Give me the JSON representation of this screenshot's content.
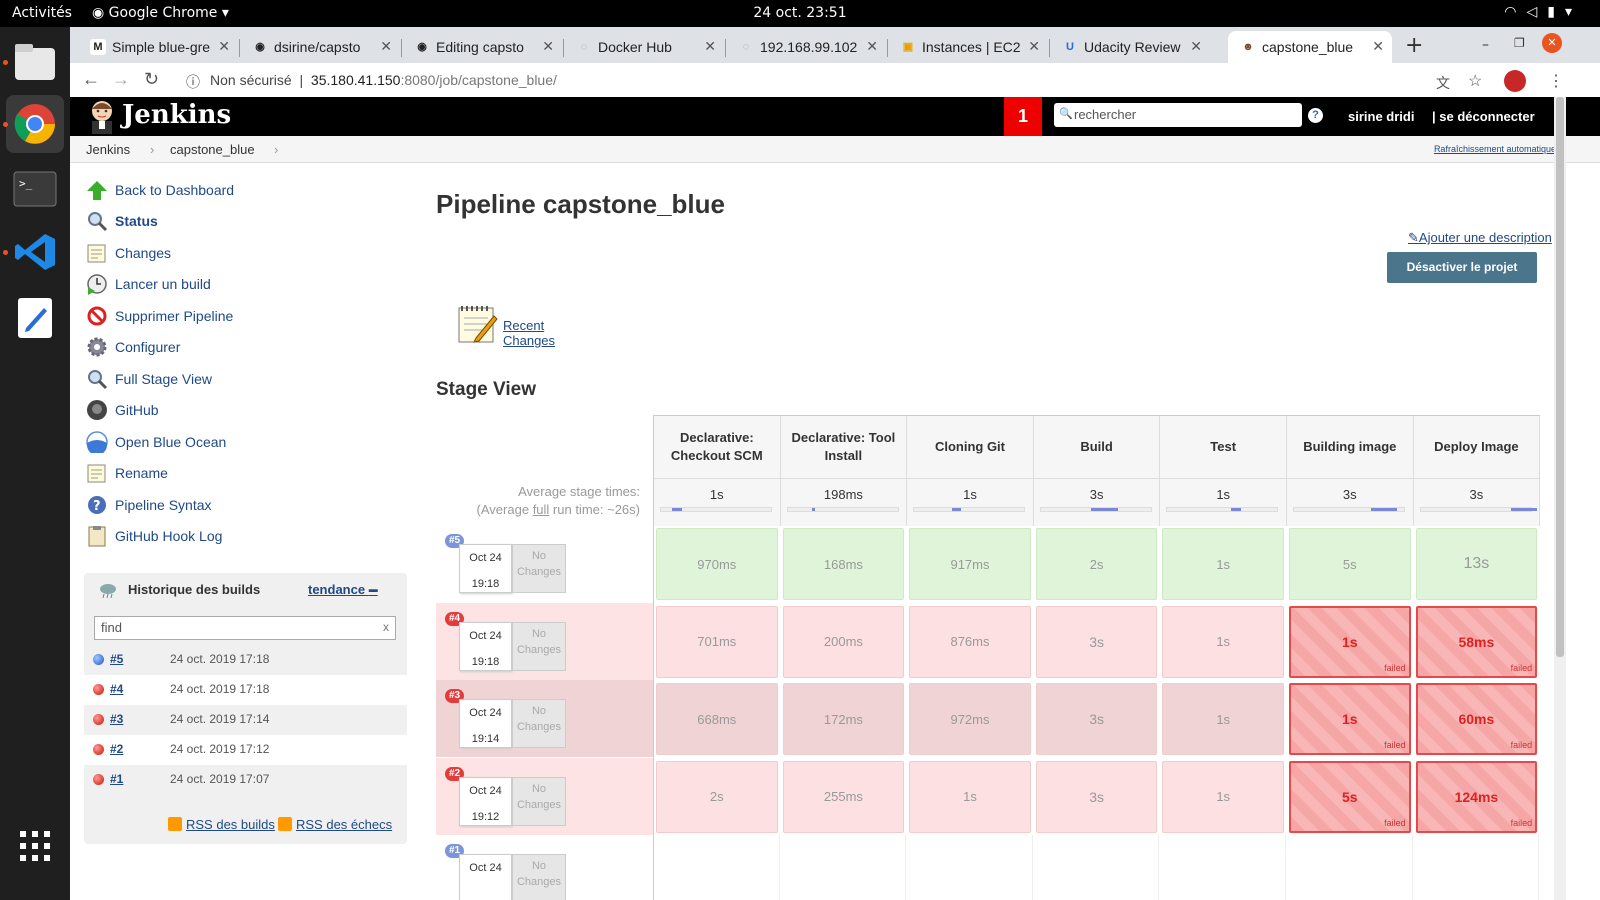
{
  "desktop": {
    "activities": "Activités",
    "app_name": "Google Chrome",
    "clock": "24 oct.  23:51"
  },
  "browser": {
    "tabs": [
      {
        "label": "Simple blue-gre",
        "icon": "M"
      },
      {
        "label": "dsirine/capsto",
        "icon": "◉"
      },
      {
        "label": "Editing capsto",
        "icon": "◉"
      },
      {
        "label": "Docker Hub",
        "icon": "◌"
      },
      {
        "label": "192.168.99.102",
        "icon": "◌"
      },
      {
        "label": "Instances | EC2",
        "icon": "▣"
      },
      {
        "label": "Udacity Review",
        "icon": "U"
      },
      {
        "label": "capstone_blue",
        "icon": "☻"
      }
    ],
    "security": "Non sécurisé",
    "url_host": "35.180.41.150",
    "url_path": ":8080/job/capstone_blue/"
  },
  "jenkins": {
    "logo": "Jenkins",
    "notification_count": "1",
    "search_placeholder": "rechercher",
    "user": "sirine dridi",
    "logout": "| se déconnecter",
    "breadcrumbs": [
      "Jenkins",
      "›",
      "capstone_blue",
      "›"
    ],
    "auto_refresh": "Rafraîchissement automatique"
  },
  "sidebar": {
    "items": [
      {
        "label": "Back to Dashboard"
      },
      {
        "label": "Status"
      },
      {
        "label": "Changes"
      },
      {
        "label": "Lancer un build"
      },
      {
        "label": "Supprimer Pipeline"
      },
      {
        "label": "Configurer"
      },
      {
        "label": "Full Stage View"
      },
      {
        "label": "GitHub"
      },
      {
        "label": "Open Blue Ocean"
      },
      {
        "label": "Rename"
      },
      {
        "label": "Pipeline Syntax"
      },
      {
        "label": "GitHub Hook Log"
      }
    ]
  },
  "history": {
    "title": "Historique des builds",
    "trend": "tendance",
    "find_placeholder": "find",
    "find_clear": "x",
    "builds": [
      {
        "num": "#5",
        "date": "24 oct. 2019 17:18",
        "status": "success"
      },
      {
        "num": "#4",
        "date": "24 oct. 2019 17:18",
        "status": "failed"
      },
      {
        "num": "#3",
        "date": "24 oct. 2019 17:14",
        "status": "failed"
      },
      {
        "num": "#2",
        "date": "24 oct. 2019 17:12",
        "status": "failed"
      },
      {
        "num": "#1",
        "date": "24 oct. 2019 17:07",
        "status": "failed"
      }
    ],
    "rss_all": "RSS des builds",
    "rss_failed": "RSS des échecs"
  },
  "main": {
    "title": "Pipeline capstone_blue",
    "add_description": "Ajouter une description",
    "disable_button": "Désactiver le projet",
    "recent_changes": "Recent Changes",
    "stage_view_title": "Stage View",
    "avg_label_1": "Average stage times:",
    "avg_label_2a": "(Average ",
    "avg_label_2b": "full",
    "avg_label_2c": " run time: ~26s)",
    "stages": [
      {
        "name": "Declarative: Checkout SCM",
        "avg": "1s",
        "avg_fraction": 0.09
      },
      {
        "name": "Declarative: Tool Install",
        "avg": "198ms",
        "avg_fraction": 0.02
      },
      {
        "name": "Cloning Git",
        "avg": "1s",
        "avg_fraction": 0.09
      },
      {
        "name": "Build",
        "avg": "3s",
        "avg_fraction": 0.24
      },
      {
        "name": "Test",
        "avg": "1s",
        "avg_fraction": 0.09
      },
      {
        "name": "Building image",
        "avg": "3s",
        "avg_fraction": 0.24
      },
      {
        "name": "Deploy Image",
        "avg": "3s",
        "avg_fraction": 0.24
      }
    ],
    "runs": [
      {
        "num": "#5",
        "date": "Oct 24",
        "time": "19:18",
        "changes": "No Changes",
        "ok": true,
        "cells": [
          {
            "t": "970ms"
          },
          {
            "t": "168ms"
          },
          {
            "t": "917ms"
          },
          {
            "t": "2s"
          },
          {
            "t": "1s"
          },
          {
            "t": "5s"
          },
          {
            "t": "13s"
          }
        ]
      },
      {
        "num": "#4",
        "date": "Oct 24",
        "time": "19:18",
        "changes": "No Changes",
        "ok": false,
        "cells": [
          {
            "t": "701ms"
          },
          {
            "t": "200ms"
          },
          {
            "t": "876ms"
          },
          {
            "t": "3s"
          },
          {
            "t": "1s"
          },
          {
            "t": "1s",
            "f": true
          },
          {
            "t": "58ms",
            "f": true
          }
        ]
      },
      {
        "num": "#3",
        "date": "Oct 24",
        "time": "19:14",
        "changes": "No Changes",
        "ok": false,
        "cells": [
          {
            "t": "668ms"
          },
          {
            "t": "172ms"
          },
          {
            "t": "972ms"
          },
          {
            "t": "3s"
          },
          {
            "t": "1s"
          },
          {
            "t": "1s",
            "f": true
          },
          {
            "t": "60ms",
            "f": true
          }
        ]
      },
      {
        "num": "#2",
        "date": "Oct 24",
        "time": "19:12",
        "changes": "No Changes",
        "ok": false,
        "cells": [
          {
            "t": "2s"
          },
          {
            "t": "255ms"
          },
          {
            "t": "1s"
          },
          {
            "t": "3s"
          },
          {
            "t": "1s"
          },
          {
            "t": "5s",
            "f": true
          },
          {
            "t": "124ms",
            "f": true
          }
        ]
      },
      {
        "num": "#1",
        "date": "Oct 24",
        "time": "",
        "changes": "No Changes",
        "ok": null,
        "cells": []
      }
    ],
    "failed_label": "failed"
  },
  "colors": {
    "success": "#4a6fe3",
    "failed": "#e32b2b",
    "accent": "#4b758b"
  }
}
